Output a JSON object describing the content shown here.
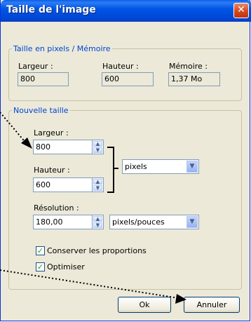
{
  "window": {
    "title": "Taille de l'image",
    "close_glyph": "✕"
  },
  "memory_group": {
    "legend": "Taille en pixels / Mémoire",
    "width_label": "Largeur :",
    "width_value": "800",
    "height_label": "Hauteur :",
    "height_value": "600",
    "memory_label": "Mémoire :",
    "memory_value": "1,37 Mo"
  },
  "new_size_group": {
    "legend": "Nouvelle taille",
    "width_label": "Largeur :",
    "width_value": "800",
    "height_label": "Hauteur :",
    "height_value": "600",
    "unit_selected": "pixels",
    "resolution_label": "Résolution :",
    "resolution_value": "180,00",
    "resolution_unit_selected": "pixels/pouces",
    "keep_proportions_label": "Conserver les proportions",
    "keep_proportions_checked": true,
    "optimize_label": "Optimiser",
    "optimize_checked": true
  },
  "buttons": {
    "ok": "Ok",
    "cancel": "Annuler"
  },
  "icons": {
    "spin_up": "▲",
    "spin_down": "▼",
    "dropdown": "▼",
    "check": "✓"
  }
}
